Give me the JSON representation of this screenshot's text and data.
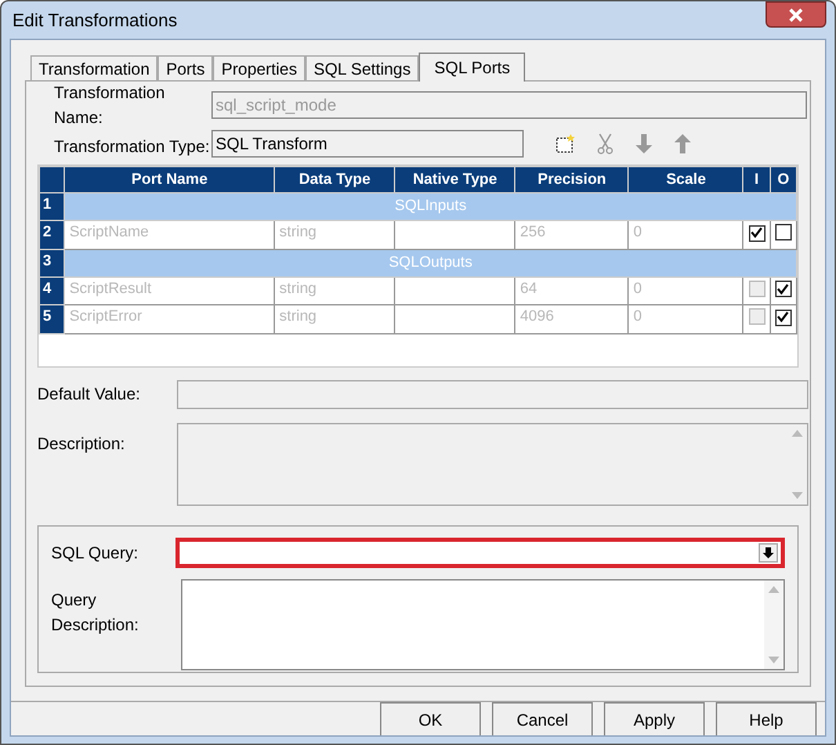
{
  "window": {
    "title": "Edit Transformations"
  },
  "tabs": [
    {
      "label": "Transformation",
      "selected": false
    },
    {
      "label": "Ports",
      "selected": false
    },
    {
      "label": "Properties",
      "selected": false
    },
    {
      "label": "SQL Settings",
      "selected": false
    },
    {
      "label": "SQL Ports",
      "selected": true
    }
  ],
  "transformation_name": {
    "label": "Transformation Name:",
    "value": "sql_script_mode",
    "disabled": true
  },
  "transformation_type": {
    "label": "Transformation Type:",
    "value": "SQL Transform",
    "disabled": false
  },
  "table": {
    "columns": [
      "Port Name",
      "Data Type",
      "Native Type",
      "Precision",
      "Scale",
      "I",
      "O"
    ],
    "rows": [
      {
        "kind": "group",
        "number": "1",
        "label": "SQLInputs"
      },
      {
        "kind": "port",
        "number": "2",
        "cells": [
          "ScriptName",
          "string",
          "",
          "256",
          "0"
        ],
        "input": {
          "checked": true,
          "disabled": false
        },
        "output": {
          "checked": false,
          "disabled": false
        }
      },
      {
        "kind": "group",
        "number": "3",
        "label": "SQLOutputs"
      },
      {
        "kind": "port",
        "number": "4",
        "cells": [
          "ScriptResult",
          "string",
          "",
          "64",
          "0"
        ],
        "input": {
          "checked": false,
          "disabled": true
        },
        "output": {
          "checked": true,
          "disabled": false
        }
      },
      {
        "kind": "port",
        "number": "5",
        "cells": [
          "ScriptError",
          "string",
          "",
          "4096",
          "0"
        ],
        "input": {
          "checked": false,
          "disabled": true
        },
        "output": {
          "checked": true,
          "disabled": false
        }
      }
    ]
  },
  "default_value": {
    "label": "Default Value:"
  },
  "description": {
    "label": "Description:"
  },
  "sql_query": {
    "label": "SQL Query:",
    "highlighted": true
  },
  "query_description": {
    "label": "Query Description:"
  },
  "buttons": [
    "OK",
    "Cancel",
    "Apply",
    "Help"
  ]
}
